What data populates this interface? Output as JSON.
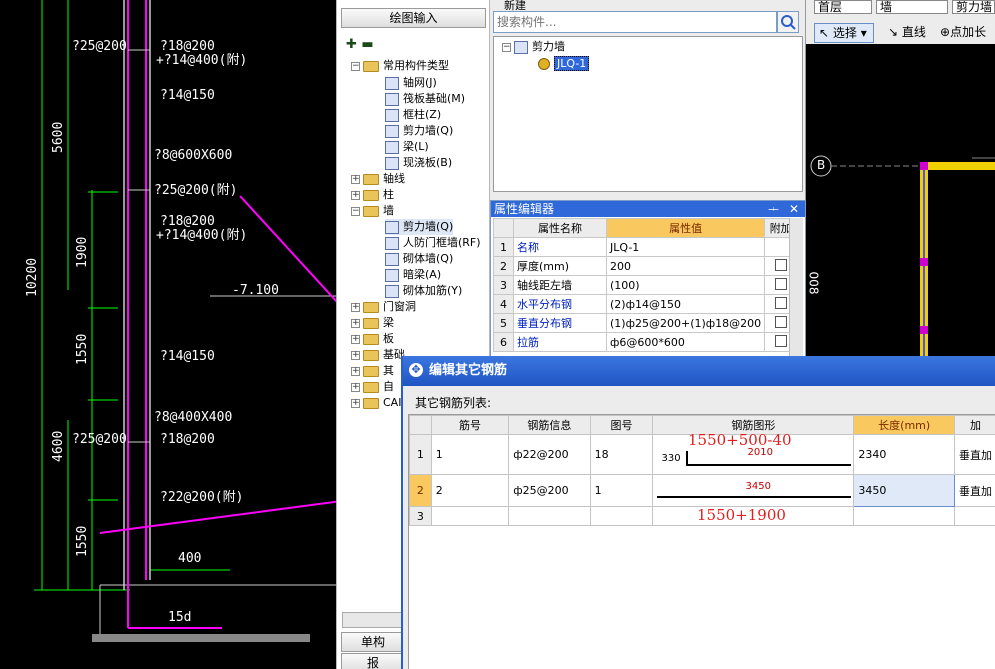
{
  "cad": {
    "labels_left": [
      "?25@200",
      "?25@200"
    ],
    "labels_mid": [
      "?18@200",
      "+?14@400(附)",
      "?14@150",
      "?8@600X600",
      "?25@200(附)",
      "?18@200",
      "+?14@400(附)",
      "?14@150",
      "?8@400X400",
      "?18@200",
      "?22@200(附)"
    ],
    "dims": [
      "5600",
      "10200",
      "1900",
      "1550",
      "4600",
      "1550",
      "400",
      "15d"
    ],
    "elevation": "-7.100"
  },
  "tree": {
    "top_button": "绘图输入",
    "root": "常用构件类型",
    "common_items": [
      "轴网(J)",
      "筏板基础(M)",
      "框柱(Z)",
      "剪力墙(Q)",
      "梁(L)",
      "现浇板(B)"
    ],
    "groups": [
      "轴线",
      "柱",
      "墙"
    ],
    "wall_items": [
      "剪力墙(Q)",
      "人防门框墙(RF)",
      "砌体墙(Q)",
      "暗梁(A)",
      "砌体加筋(Y)"
    ],
    "more_groups": [
      "门窗洞",
      "梁",
      "板",
      "基础",
      "其",
      "自",
      "CAI"
    ],
    "bottom_buttons": [
      "单构",
      "报"
    ]
  },
  "components": {
    "top_label": "新建",
    "search": {
      "placeholder": "搜索构件..."
    },
    "root": "剪力墙",
    "child": "JLQ-1"
  },
  "props": {
    "title": "属性编辑器",
    "pin": "ᆠ",
    "headers": [
      "属性名称",
      "属性值",
      "附加"
    ],
    "rows": [
      {
        "n": "1",
        "name": "名称",
        "value": "JLQ-1",
        "blue": true
      },
      {
        "n": "2",
        "name": "厚度(mm)",
        "value": "200",
        "blue": false
      },
      {
        "n": "3",
        "name": "轴线距左墙",
        "value": "(100)",
        "blue": false
      },
      {
        "n": "4",
        "name": "水平分布钢",
        "value": "(2)ф14@150",
        "blue": true
      },
      {
        "n": "5",
        "name": "垂直分布钢",
        "value": "(1)ф25@200+(1)ф18@200",
        "blue": true
      },
      {
        "n": "6",
        "name": "拉筋",
        "value": "ф6@600*600",
        "blue": true
      }
    ]
  },
  "toolbar": {
    "floor": "首层",
    "type": "墙",
    "comp": "剪力墙",
    "select": "选择",
    "line": "直线",
    "point": "点加长"
  },
  "dialog": {
    "title": "编辑其它钢筋",
    "subtitle": "其它钢筋列表:",
    "headers": [
      "筋号",
      "钢筋信息",
      "图号",
      "钢筋图形",
      "长度(mm)",
      "加"
    ],
    "rows": [
      {
        "n": "1",
        "no": "1",
        "info": "ф22@200",
        "fig": "18",
        "shape_left": "330",
        "shape_mid": "2010",
        "length": "2340",
        "extra": "垂直加"
      },
      {
        "n": "2",
        "no": "2",
        "info": "ф25@200",
        "fig": "1",
        "shape_left": "",
        "shape_mid": "3450",
        "length": "3450",
        "extra": "垂直加"
      },
      {
        "n": "3",
        "no": "",
        "info": "",
        "fig": "",
        "shape_left": "",
        "shape_mid": "",
        "length": "",
        "extra": ""
      }
    ],
    "annotation1": "1550+500-40",
    "annotation2": "1550+1900"
  },
  "right_draw": {
    "axis": "B",
    "dim": "008"
  },
  "colors": {
    "title_blue": "#2a5fc8",
    "highlight": "#f9c85e",
    "magenta": "#ff00ff",
    "cad_green": "#00ff00"
  }
}
